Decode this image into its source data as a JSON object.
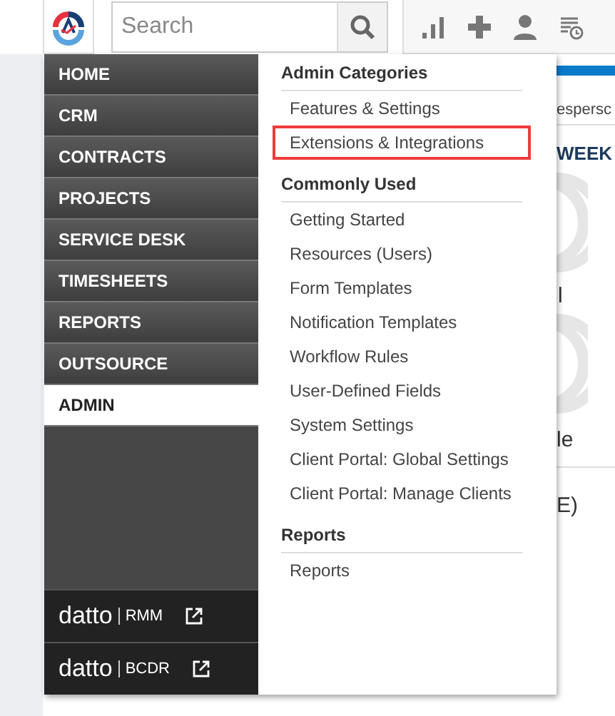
{
  "top_bar": {
    "search": {
      "placeholder": "Search"
    }
  },
  "nav": {
    "items": [
      {
        "label": "HOME",
        "selected": false
      },
      {
        "label": "CRM",
        "selected": false
      },
      {
        "label": "CONTRACTS",
        "selected": false
      },
      {
        "label": "PROJECTS",
        "selected": false
      },
      {
        "label": "SERVICE DESK",
        "selected": false
      },
      {
        "label": "TIMESHEETS",
        "selected": false
      },
      {
        "label": "REPORTS",
        "selected": false
      },
      {
        "label": "OUTSOURCE",
        "selected": false
      },
      {
        "label": "ADMIN",
        "selected": true
      }
    ],
    "external_links": [
      {
        "brand": "datto",
        "product": "RMM"
      },
      {
        "brand": "datto",
        "product": "BCDR"
      }
    ]
  },
  "menu": {
    "sections": [
      {
        "heading": "Admin Categories",
        "items": [
          {
            "label": "Features & Settings",
            "highlighted": false
          },
          {
            "label": "Extensions & Integrations",
            "highlighted": true
          }
        ]
      },
      {
        "heading": "Commonly Used",
        "items": [
          {
            "label": "Getting Started",
            "highlighted": false
          },
          {
            "label": "Resources (Users)",
            "highlighted": false
          },
          {
            "label": "Form Templates",
            "highlighted": false
          },
          {
            "label": "Notification Templates",
            "highlighted": false
          },
          {
            "label": "Workflow Rules",
            "highlighted": false
          },
          {
            "label": "User-Defined Fields",
            "highlighted": false
          },
          {
            "label": "System Settings",
            "highlighted": false
          },
          {
            "label": "Client Portal: Global Settings",
            "highlighted": false
          },
          {
            "label": "Client Portal: Manage Clients",
            "highlighted": false
          }
        ]
      },
      {
        "heading": "Reports",
        "items": [
          {
            "label": "Reports",
            "highlighted": false
          }
        ]
      }
    ]
  },
  "background": {
    "tab_text": "espersc",
    "heading": "WEEK",
    "label_1": "l",
    "label_2": "le",
    "label_3": "E)"
  }
}
